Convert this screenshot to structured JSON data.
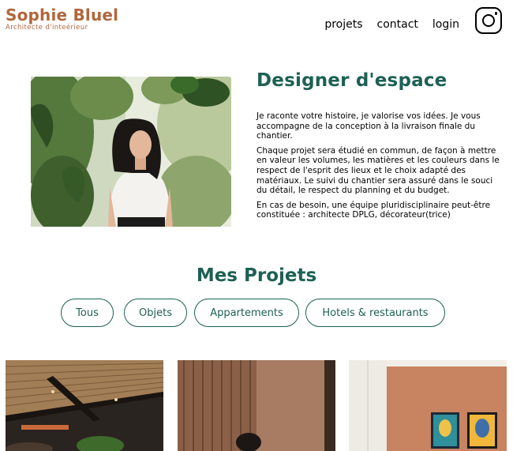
{
  "header": {
    "brand_name": "Sophie Bluel",
    "brand_subtitle": "Architecte d'inteérieur",
    "nav": [
      {
        "label": "projets"
      },
      {
        "label": "contact"
      },
      {
        "label": "login"
      }
    ],
    "social_icon": "instagram-icon"
  },
  "introduction": {
    "title": "Designer d'espace",
    "paragraphs": [
      "Je raconte votre histoire, je valorise vos idées. Je vous accompagne de la conception à la livraison finale du chantier.",
      "Chaque projet sera étudié en commun, de façon à mettre en valeur les volumes, les matières et les couleurs dans le respect de l'esprit des lieux et le choix adapté des matériaux. Le suivi du chantier sera assuré dans le souci du détail, le respect du planning et du budget.",
      "En cas de besoin, une équipe pluridisciplinaire peut-être constituée : architecte DPLG, décorateur(trice)"
    ]
  },
  "portfolio": {
    "title": "Mes Projets",
    "filters": [
      {
        "label": "Tous"
      },
      {
        "label": "Objets"
      },
      {
        "label": "Appartements"
      },
      {
        "label": "Hotels & restaurants"
      }
    ]
  },
  "colors": {
    "brand": "#b1663c",
    "accent": "#1d6154"
  }
}
